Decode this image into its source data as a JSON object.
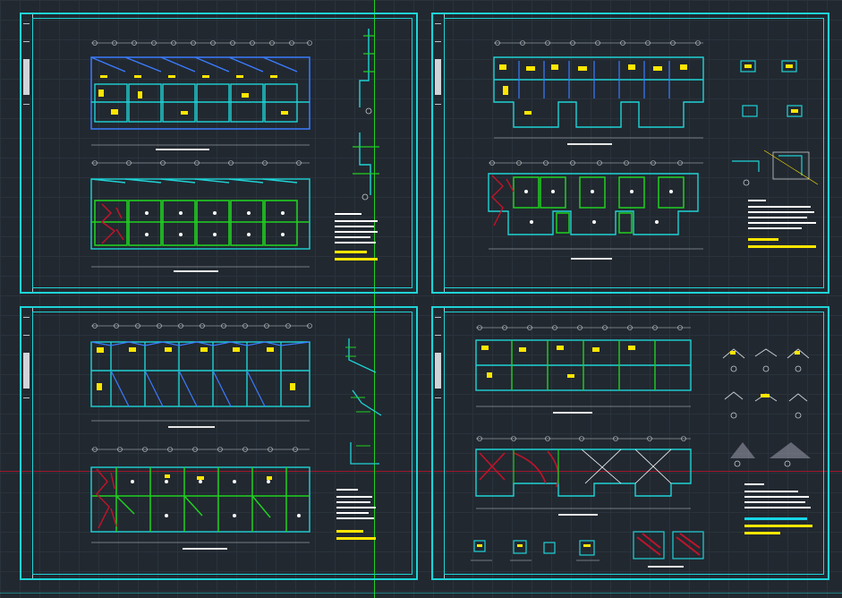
{
  "drawing": {
    "sheets": [
      {
        "id": "sheet-1",
        "plans": 2,
        "details": 2
      },
      {
        "id": "sheet-2",
        "plans": 2,
        "details": 3
      },
      {
        "id": "sheet-3",
        "plans": 2,
        "details": 3
      },
      {
        "id": "sheet-4",
        "plans": 2,
        "details": 12
      }
    ]
  },
  "colors": {
    "background": "#212830",
    "frame": "#1fd3d6",
    "wall": "#1fd3d6",
    "beam": "#20d020",
    "outline": "#3b7cff",
    "rebar_note": "#ffe600",
    "section": "#c0142a",
    "text": "#ffffff"
  },
  "icons": {
    "axis_bubble": "circle-axis-marker",
    "section_mark": "section-marker"
  }
}
